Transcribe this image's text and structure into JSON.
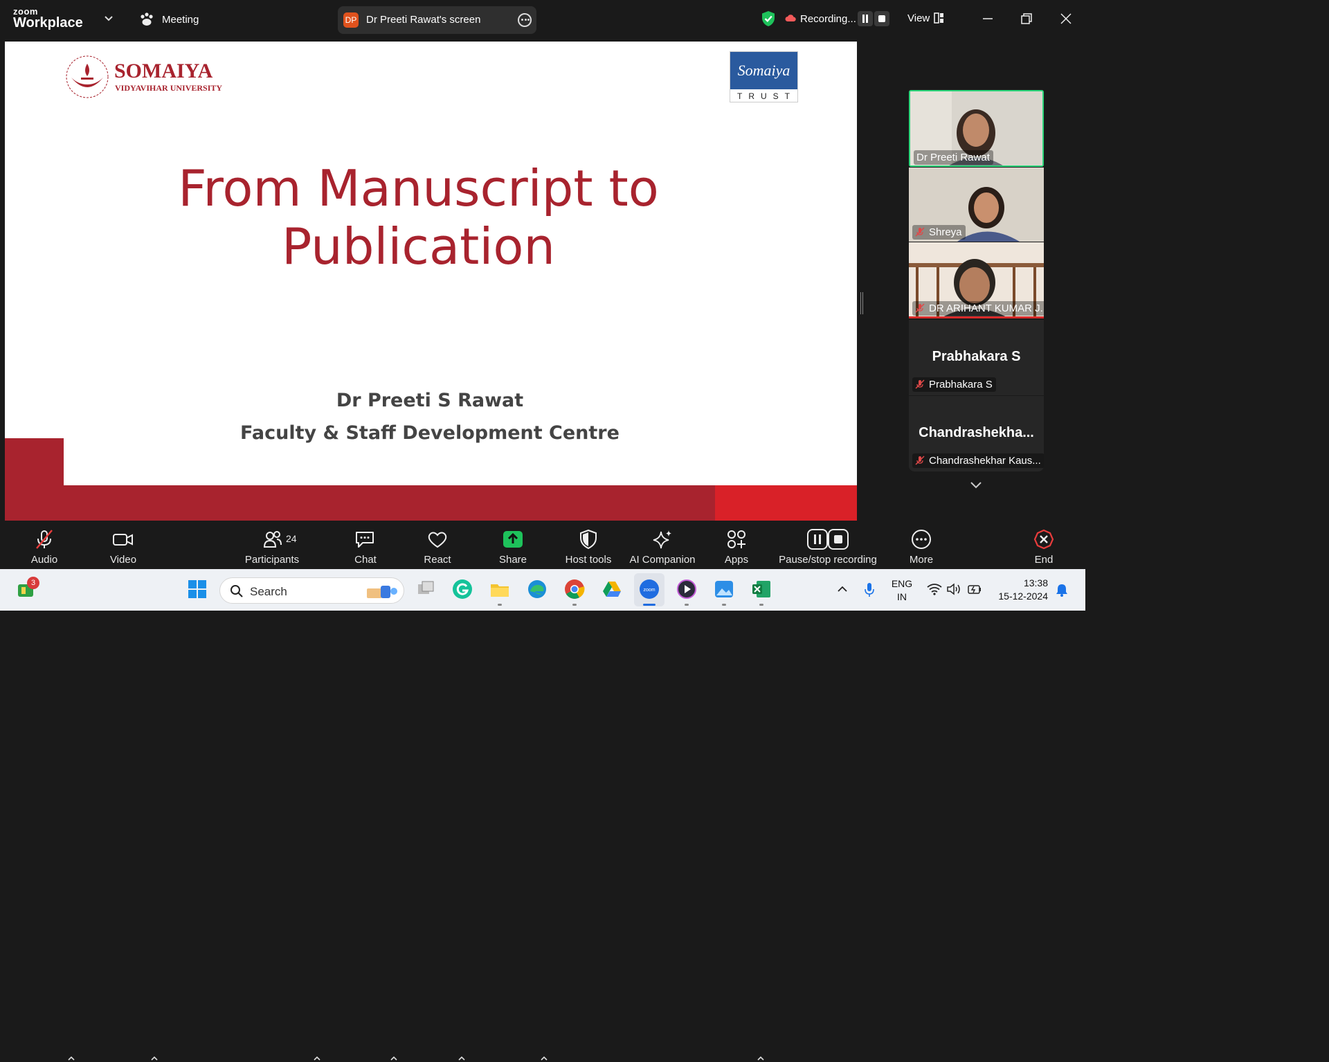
{
  "app": {
    "brand_small": "zoom",
    "brand_big": "Workplace",
    "meeting_label": "Meeting",
    "screen_initials": "DP",
    "screen_label": "Dr Preeti Rawat's screen",
    "recording_label": "Recording...",
    "view_label": "View"
  },
  "slide": {
    "logo_name": "SOMAIYA",
    "logo_sub": "VIDYAVIHAR UNIVERSITY",
    "logo_ring_text": "Knowledge Alone Liberates · Somaiya Vidyavihar",
    "trust_script": "Somaiya",
    "trust_word": "TRUST",
    "title_line1": "From Manuscript to",
    "title_line2": "Publication",
    "presenter": "Dr Preeti S Rawat",
    "department": "Faculty & Staff Development Centre",
    "colors": {
      "maroon": "#a8232e",
      "red": "#d92128",
      "trust_blue": "#2a5a9e"
    }
  },
  "participants": [
    {
      "name": "Dr Preeti Rawat",
      "muted": false,
      "video": true,
      "active_speaker": true
    },
    {
      "name": "Shreya",
      "muted": true,
      "video": true
    },
    {
      "name": "DR ARIHANT KUMAR J...",
      "muted": true,
      "video": true
    },
    {
      "display": "Prabhakara S",
      "name": "Prabhakara S",
      "muted": true,
      "video": false
    },
    {
      "display": "Chandrashekha...",
      "name": "Chandrashekhar Kaus...",
      "muted": true,
      "video": false
    }
  ],
  "toolbar": {
    "audio": "Audio",
    "video": "Video",
    "participants": "Participants",
    "participant_count": "24",
    "chat": "Chat",
    "react": "React",
    "share": "Share",
    "host_tools": "Host tools",
    "ai_companion": "AI Companion",
    "apps": "Apps",
    "pause_recording": "Pause/stop recording",
    "more": "More",
    "end": "End"
  },
  "taskbar": {
    "search_label": "Search",
    "notification_badge": "3",
    "lang_top": "ENG",
    "lang_bottom": "IN",
    "time": "13:38",
    "date": "15-12-2024"
  }
}
